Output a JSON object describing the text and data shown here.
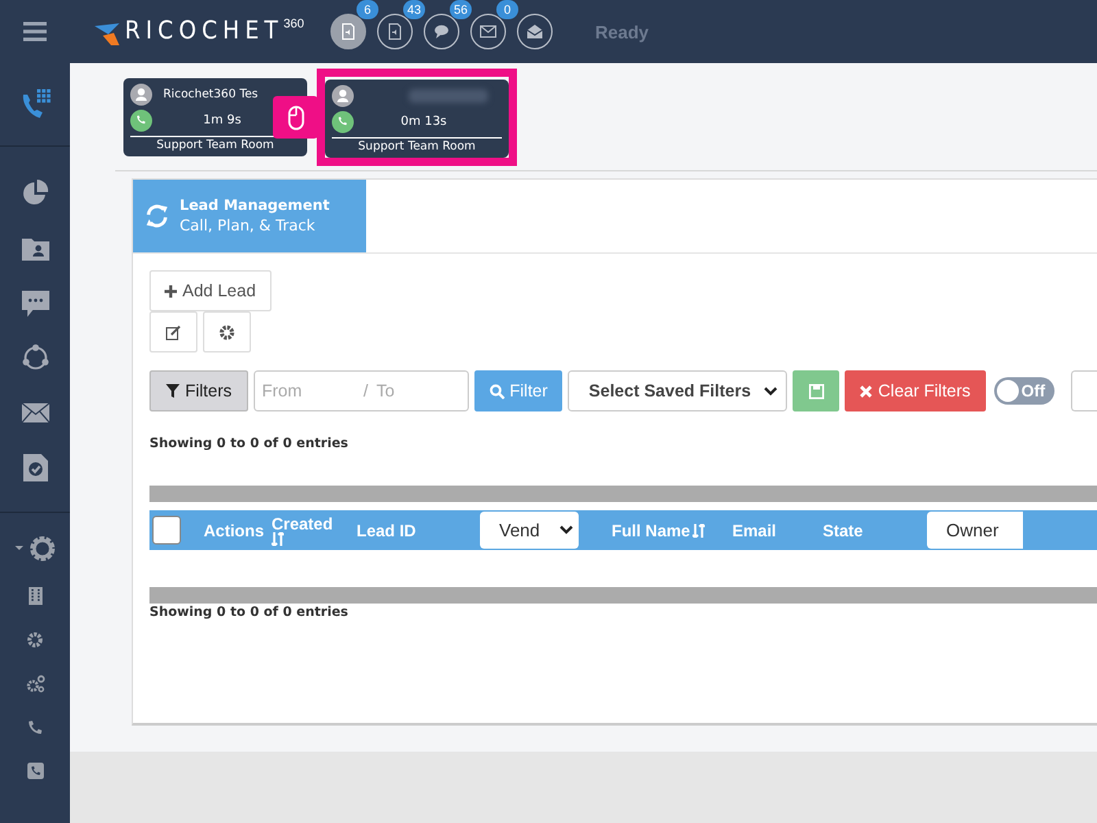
{
  "header": {
    "logo": "RICOCHET",
    "logo_sup": "360",
    "status": "Ready"
  },
  "header_icons": [
    {
      "kind": "doc",
      "count": "6",
      "selected": true
    },
    {
      "kind": "doc",
      "count": "43",
      "selected": false
    },
    {
      "kind": "chat",
      "count": "56",
      "selected": false
    },
    {
      "kind": "mail",
      "count": "0",
      "selected": false
    },
    {
      "kind": "mail-open",
      "selected": false
    }
  ],
  "sidebar": {
    "items": [
      {
        "kind": "dialer",
        "selected": true
      },
      {
        "kind": "pie",
        "selected": false
      },
      {
        "kind": "folder",
        "selected": false
      },
      {
        "kind": "chat",
        "selected": false
      },
      {
        "kind": "share",
        "selected": false
      },
      {
        "kind": "mail",
        "selected": false
      },
      {
        "kind": "task",
        "selected": false
      }
    ],
    "bottom_items": [
      {
        "kind": "gear-caret"
      },
      {
        "kind": "building"
      },
      {
        "kind": "gear"
      },
      {
        "kind": "gears"
      },
      {
        "kind": "phone"
      },
      {
        "kind": "phone-square"
      }
    ]
  },
  "calls": [
    {
      "name": "Ricochet360 Tes",
      "duration": "1m 9s",
      "room": "Support Team Room",
      "highlighted": false
    },
    {
      "duration": "0m 13s",
      "room": "Support Team Room",
      "highlighted": true
    }
  ],
  "tab": {
    "title": "Lead Management",
    "subtitle": "Call, Plan, & Track",
    "selected": true
  },
  "add_button": "Add Lead",
  "filters": {
    "filters_button": "Filters",
    "from_placeholder": "From",
    "separator": "/",
    "to_placeholder": "To",
    "filter_button": "Filter",
    "saved_select": "Select Saved Filters",
    "clear_button": "Clear Filters",
    "toggle": {
      "label": "Off",
      "on": false
    }
  },
  "summary_top": "Showing 0 to 0 of 0 entries",
  "table": {
    "columns": [
      {
        "kind": "checkbox",
        "checked": false
      },
      {
        "kind": "text",
        "label": "Actions"
      },
      {
        "kind": "sort",
        "label": "Created"
      },
      {
        "kind": "text",
        "label": "Lead ID"
      },
      {
        "kind": "select",
        "label": "Vend"
      },
      {
        "kind": "sort-inline",
        "label": "Full Name"
      },
      {
        "kind": "text",
        "label": "Email"
      },
      {
        "kind": "text",
        "label": "State"
      },
      {
        "kind": "box",
        "label": "Owner"
      }
    ]
  },
  "summary_bottom": "Showing 0 to 0 of 0 entries"
}
